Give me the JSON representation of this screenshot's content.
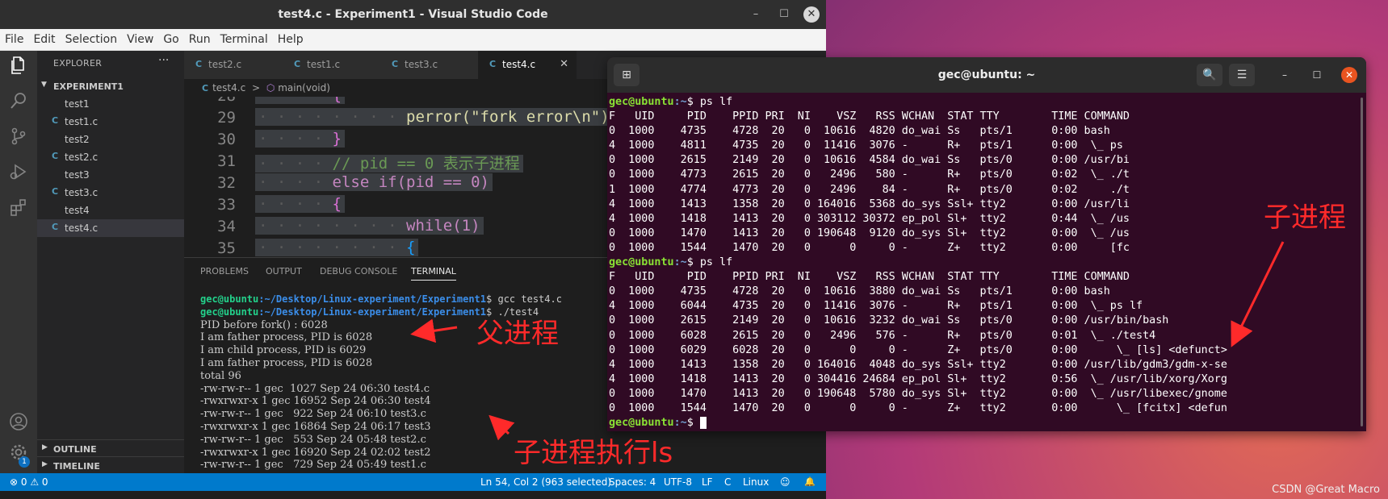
{
  "vscode": {
    "title": "test4.c - Experiment1 - Visual Studio Code",
    "window_controls": {
      "minimize": "–",
      "maximize": "☐",
      "close": "✕"
    },
    "menu": [
      "File",
      "Edit",
      "Selection",
      "View",
      "Go",
      "Run",
      "Terminal",
      "Help"
    ],
    "explorer": {
      "header": "EXPLORER",
      "more": "···",
      "folder": "EXPERIMENT1",
      "files": [
        {
          "icon": "",
          "name": "test1"
        },
        {
          "icon": "C",
          "name": "test1.c"
        },
        {
          "icon": "",
          "name": "test2"
        },
        {
          "icon": "C",
          "name": "test2.c"
        },
        {
          "icon": "",
          "name": "test3"
        },
        {
          "icon": "C",
          "name": "test3.c"
        },
        {
          "icon": "",
          "name": "test4"
        },
        {
          "icon": "C",
          "name": "test4.c"
        }
      ],
      "selected_file": "test4.c",
      "outline": "OUTLINE",
      "timeline": "TIMELINE",
      "settings_badge": "1"
    },
    "tabs": [
      {
        "icon": "C",
        "label": "test2.c"
      },
      {
        "icon": "C",
        "label": "test1.c"
      },
      {
        "icon": "C",
        "label": "test3.c"
      },
      {
        "icon": "C",
        "label": "test4.c",
        "active": true,
        "close": "✕"
      }
    ],
    "breadcrumb": {
      "file": "test4.c",
      "separator": ">",
      "symbol": "main(void)"
    },
    "code": {
      "line_numbers": [
        "28",
        "29",
        "30",
        "31",
        "32",
        "33",
        "34",
        "35"
      ],
      "lines": [
        "{",
        "perror(\"fork error\\n\");",
        "}",
        "// pid == 0 表示子进程",
        "else if(pid == 0)",
        "{",
        "while(1)",
        "{"
      ]
    },
    "panel": {
      "tabs": [
        "PROBLEMS",
        "OUTPUT",
        "DEBUG CONSOLE",
        "TERMINAL"
      ],
      "active_tab": "TERMINAL",
      "prompt_user": "gec@ubuntu",
      "prompt_path": ":~/Desktop/Linux-experiment/Experiment1",
      "cmd1": "$ gcc test4.c",
      "cmd2": "$ ./test4",
      "output": [
        "PID before fork() : 6028",
        "I am father process, PID is 6028",
        "I am child process, PID is 6029",
        "I am father process, PID is 6028",
        "total 96",
        "-rw-rw-r-- 1 gec  1027 Sep 24 06:30 test4.c",
        "-rwxrwxr-x 1 gec 16952 Sep 24 06:30 test4",
        "-rw-rw-r-- 1 gec   922 Sep 24 06:10 test3.c",
        "-rwxrwxr-x 1 gec 16864 Sep 24 06:17 test3",
        "-rw-rw-r-- 1 gec   553 Sep 24 05:48 test2.c",
        "-rwxrwxr-x 1 gec 16920 Sep 24 02:02 test2",
        "-rw-rw-r-- 1 gec   729 Sep 24 05:49 test1.c"
      ]
    },
    "status": {
      "errors": "⊗ 0 ⚠ 0",
      "position": "Ln 54, Col 2 (963 selected)",
      "spaces": "Spaces: 4",
      "encoding": "UTF-8",
      "eol": "LF",
      "lang_short": "C",
      "platform": "Linux",
      "feedback_icon": "☺",
      "bell_icon": "🔔"
    }
  },
  "terminal": {
    "title": "gec@ubuntu: ~",
    "buttons": {
      "new_tab": "⊞",
      "search": "🔍",
      "menu": "☰",
      "minimize": "–",
      "maximize": "☐",
      "close": "✕"
    },
    "prompt_user": "gec@ubuntu",
    "prompt_path": ":~",
    "cmd": "$ ps lf",
    "header": "F   UID     PID    PPID PRI  NI    VSZ   RSS WCHAN  STAT TTY        TIME COMMAND",
    "ps1": [
      "0  1000    4735    4728  20   0  10616  4820 do_wai Ss   pts/1      0:00 bash",
      "4  1000    4811    4735  20   0  11416  3076 -      R+   pts/1      0:00  \\_ ps",
      "0  1000    2615    2149  20   0  10616  4584 do_wai Ss   pts/0      0:00 /usr/bi",
      "0  1000    4773    2615  20   0   2496   580 -      R+   pts/0      0:02  \\_ ./t",
      "1  1000    4774    4773  20   0   2496    84 -      R+   pts/0      0:02     ./t",
      "4  1000    1413    1358  20   0 164016  5368 do_sys Ssl+ tty2       0:00 /usr/li",
      "4  1000    1418    1413  20   0 303112 30372 ep_pol Sl+  tty2       0:44  \\_ /us",
      "0  1000    1470    1413  20   0 190648  9120 do_sys Sl+  tty2       0:00  \\_ /us",
      "0  1000    1544    1470  20   0      0     0 -      Z+   tty2       0:00     [fc"
    ],
    "ps2": [
      "0  1000    4735    4728  20   0  10616  3880 do_wai Ss   pts/1      0:00 bash",
      "4  1000    6044    4735  20   0  11416  3076 -      R+   pts/1      0:00  \\_ ps lf",
      "0  1000    2615    2149  20   0  10616  3232 do_wai Ss   pts/0      0:00 /usr/bin/bash",
      "0  1000    6028    2615  20   0   2496   576 -      R+   pts/0      0:01  \\_ ./test4",
      "0  1000    6029    6028  20   0      0     0 -      Z+   pts/0      0:00      \\_ [ls] <defunct>",
      "4  1000    1413    1358  20   0 164016  4048 do_sys Ssl+ tty2       0:00 /usr/lib/gdm3/gdm-x-se",
      "4  1000    1418    1413  20   0 304416 24684 ep_pol Sl+  tty2       0:56  \\_ /usr/lib/xorg/Xorg",
      "0  1000    1470    1413  20   0 190648  5780 do_sys Sl+  tty2       0:00  \\_ /usr/libexec/gnome",
      "0  1000    1544    1470  20   0      0     0 -      Z+   tty2       0:00      \\_ [fcitx] <defun"
    ]
  },
  "annotations": {
    "parent_process": "父进程",
    "child_process_ls": "子进程执行ls",
    "child_process": "子进程"
  },
  "watermark": "CSDN @Great Macro",
  "colors": {
    "vscode_status_bar": "#007acc",
    "terminal_bg": "#300a24",
    "annotation_red": "#ff2a2a",
    "prompt_green": "#8ae234",
    "prompt_blue": "#729fcf"
  }
}
